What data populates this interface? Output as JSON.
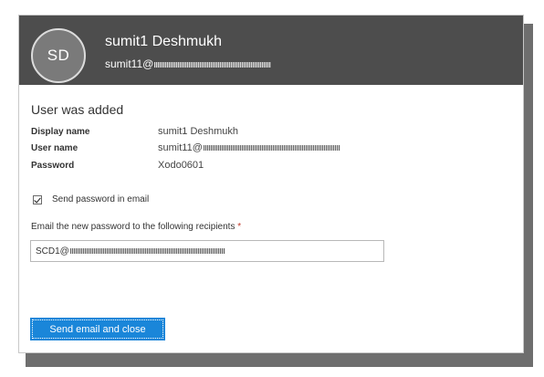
{
  "header": {
    "avatar_initials": "SD",
    "display_name": "sumit1 Deshmukh",
    "email_prefix": "sumit11@"
  },
  "main": {
    "title": "User was added",
    "fields": [
      {
        "label": "Display name",
        "value": "sumit1 Deshmukh"
      },
      {
        "label": "User name",
        "value": "sumit11@"
      },
      {
        "label": "Password",
        "value": "Xodo0601"
      }
    ],
    "send_password_checkbox": {
      "label": "Send password in email",
      "checked": true
    },
    "recipients_label": "Email the new password to the following recipients",
    "required_marker": "*",
    "recipients_value_prefix": "SCD1@"
  },
  "actions": {
    "send_button_label": "Send email and close"
  },
  "colors": {
    "header_bg": "#4d4d4d",
    "primary_button": "#1a86d9"
  }
}
